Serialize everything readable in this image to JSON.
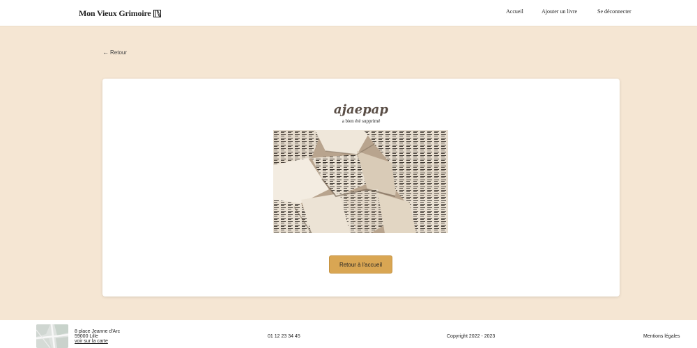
{
  "header": {
    "logo_text": "Mon Vieux Grimoire",
    "nav": {
      "home": "Accueil",
      "add_book": "Ajouter un livre",
      "logout": "Se déconnecter"
    }
  },
  "back_link": {
    "icon": "arrow-left-icon",
    "label": "Retour"
  },
  "confirmation": {
    "book_title": "ajaepap",
    "status": "a bien été supprimé",
    "image": "crumpled-book-pages-image",
    "button_label": "Retour à l'accueil"
  },
  "footer": {
    "address_line1": "8 place Jeanne d'Arc",
    "address_line2": "59000 Lille",
    "map_link": "voir sur la carte",
    "phone": "01 12 23 34 45",
    "copyright": "Copyright 2022 - 2023",
    "legal": "Mentions légales"
  },
  "colors": {
    "page_background": "#f5e6d3",
    "accent_button": "#d9a653",
    "title_color": "#5a4e46"
  }
}
